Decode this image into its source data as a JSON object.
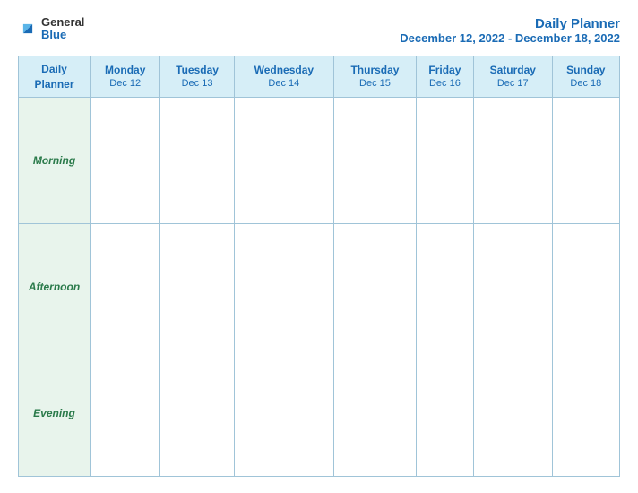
{
  "header": {
    "logo": {
      "general": "General",
      "blue": "Blue"
    },
    "title": "Daily Planner",
    "date_range": "December 12, 2022 - December 18, 2022"
  },
  "table": {
    "row_header_label": "Daily\nPlanner",
    "columns": [
      {
        "day": "Monday",
        "date": "Dec 12"
      },
      {
        "day": "Tuesday",
        "date": "Dec 13"
      },
      {
        "day": "Wednesday",
        "date": "Dec 14"
      },
      {
        "day": "Thursday",
        "date": "Dec 15"
      },
      {
        "day": "Friday",
        "date": "Dec 16"
      },
      {
        "day": "Saturday",
        "date": "Dec 17"
      },
      {
        "day": "Sunday",
        "date": "Dec 18"
      }
    ],
    "rows": [
      {
        "label": "Morning"
      },
      {
        "label": "Afternoon"
      },
      {
        "label": "Evening"
      }
    ]
  }
}
